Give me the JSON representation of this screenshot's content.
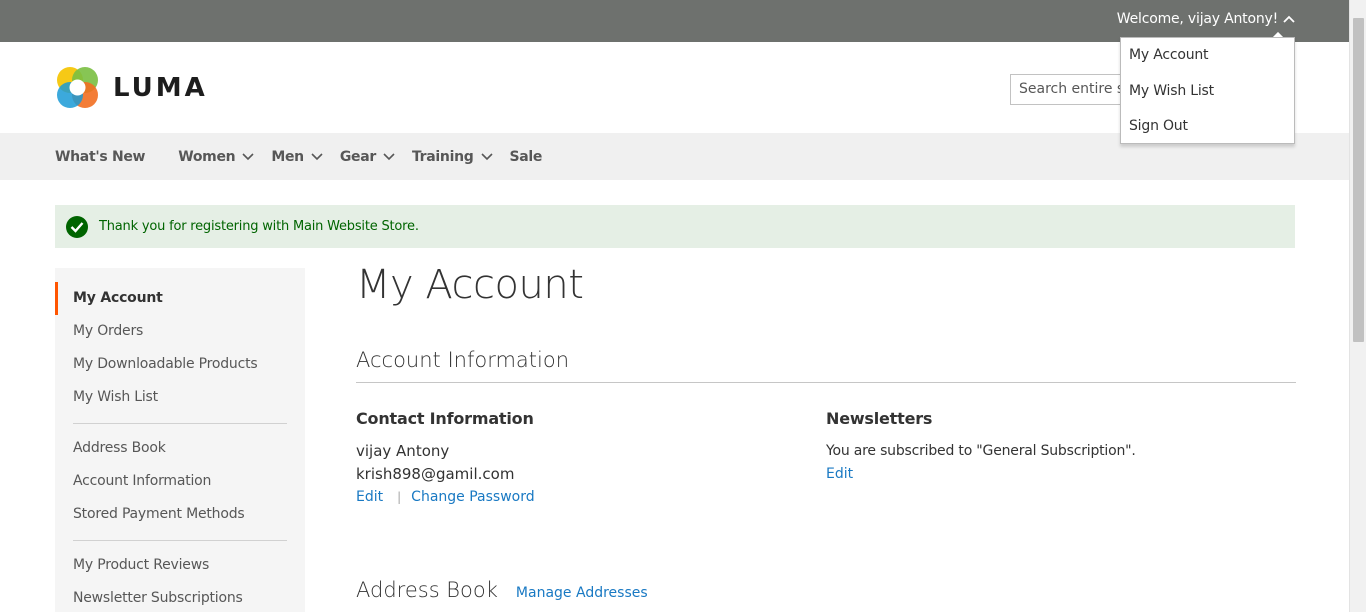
{
  "topbar": {
    "welcome": "Welcome, vijay Antony!"
  },
  "account_menu": {
    "items": [
      "My Account",
      "My Wish List",
      "Sign Out"
    ]
  },
  "header": {
    "logo_text": "LUMA",
    "search_placeholder": "Search entire store here..."
  },
  "nav": {
    "items": [
      "What's New",
      "Women",
      "Men",
      "Gear",
      "Training",
      "Sale"
    ]
  },
  "message": {
    "text": "Thank you for registering with Main Website Store."
  },
  "sidebar": {
    "group1": [
      "My Account",
      "My Orders",
      "My Downloadable Products",
      "My Wish List"
    ],
    "group2": [
      "Address Book",
      "Account Information",
      "Stored Payment Methods"
    ],
    "group3": [
      "My Product Reviews",
      "Newsletter Subscriptions"
    ]
  },
  "main": {
    "title": "My Account",
    "section_title": "Account Information",
    "contact": {
      "title": "Contact Information",
      "name": "vijay Antony",
      "email": "krish898@gamil.com",
      "edit_label": "Edit",
      "change_password_label": "Change Password"
    },
    "newsletters": {
      "title": "Newsletters",
      "text": "You are subscribed to \"General Subscription\".",
      "edit_label": "Edit"
    },
    "address_book": {
      "title": "Address Book",
      "manage_label": "Manage Addresses"
    }
  },
  "colors": {
    "accent": "#ff5501",
    "link": "#1979c3",
    "topbar": "#6e716e",
    "success": "#006400"
  }
}
